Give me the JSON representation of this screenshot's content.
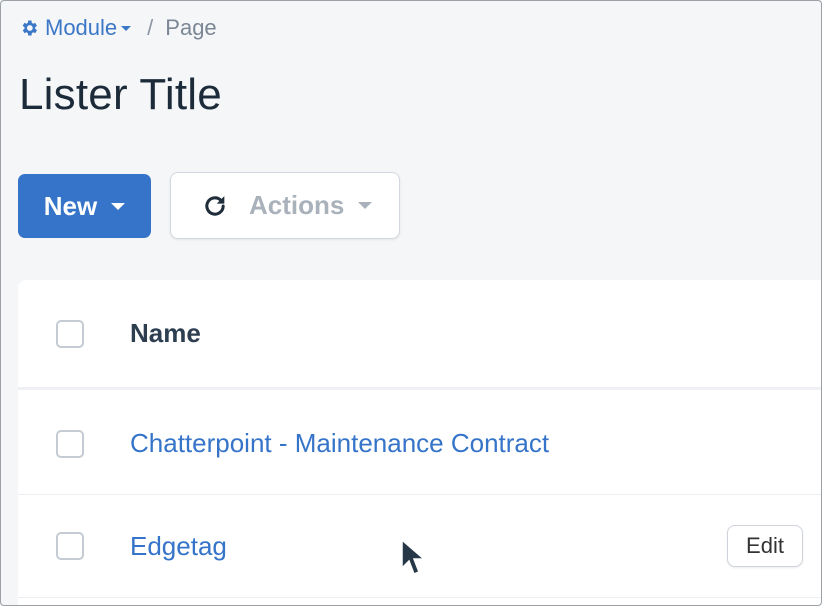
{
  "breadcrumb": {
    "module_label": "Module",
    "separator": "/",
    "page_label": "Page",
    "module_icon": "gear-icon"
  },
  "page": {
    "title": "Lister Title"
  },
  "toolbar": {
    "new_label": "New",
    "actions_label": "Actions",
    "actions_icon": "refresh-icon"
  },
  "table": {
    "columns": [
      "Name"
    ],
    "rows": [
      {
        "name": "Chatterpoint - Maintenance Contract",
        "edit_label": ""
      },
      {
        "name": "Edgetag",
        "edit_label": "Edit"
      }
    ]
  },
  "colors": {
    "primary": "#3574c8",
    "link": "#3574c8",
    "title": "#1c2b3a",
    "muted": "#a9b1bb"
  }
}
